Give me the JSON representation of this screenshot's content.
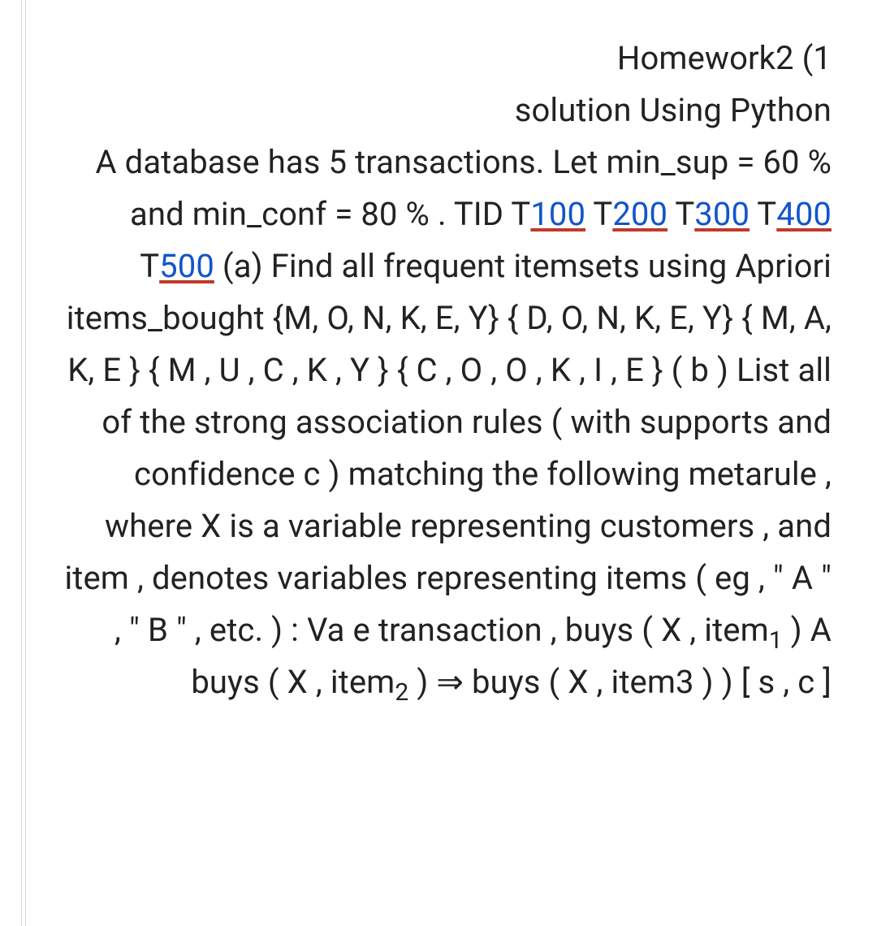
{
  "title_line1": "Homework2 (1",
  "title_line2": "solution Using  Python",
  "body_part1": "A database has 5 transactions.  Let min_sup = 60 % and min_conf = 80 % .  TID ",
  "tid_prefix": "T",
  "tids": [
    "100",
    "200",
    "300",
    "400",
    "500"
  ],
  "body_part2": " (a) Find all frequent itemsets using Apriori items_bought {M, O, N, K, E, Y} { D, O, N, K, E, Y} { M, A, K, E  } { M , U , C , K , Y } { C , O , O , K , I , E } ( b ) List all of the strong association rules ( with supports and confidence c ) matching the following metarule , where X is  a variable representing customers , and item , denotes variables representing items ( eg , \" A \" , \" B \" , etc. ) : Va e transaction , buys ( X , item",
  "sub1": "1",
  "body_part3": " ) A buys ( X , item",
  "sub2": "2",
  "body_part4": " ) ",
  "arrow": "⇒",
  "body_part5": " buys ( X , item3 )  ) [ s , c ]"
}
